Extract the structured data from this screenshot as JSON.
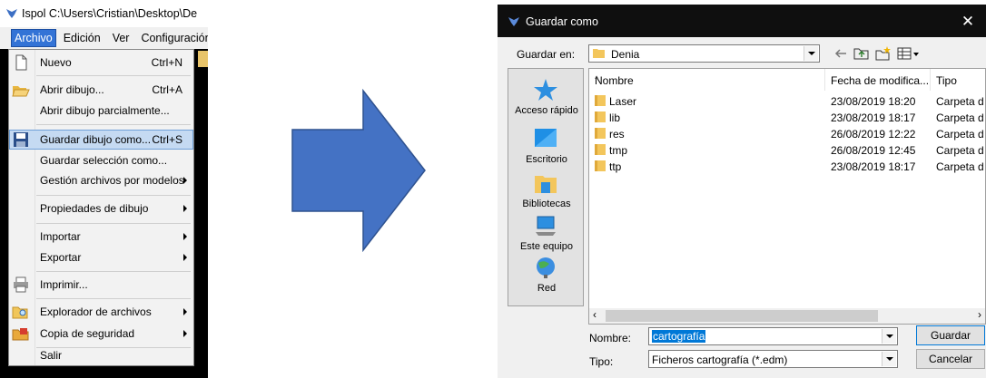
{
  "app": {
    "title": "Ispol  C:\\Users\\Cristian\\Desktop\\De",
    "menubar": [
      "Archivo",
      "Edición",
      "Ver",
      "Configuración"
    ]
  },
  "menu": {
    "items": [
      {
        "label": "Nuevo",
        "shortcut": "Ctrl+N",
        "icon": "new-document-icon"
      },
      {
        "label": "Abrir dibujo...",
        "shortcut": "Ctrl+A",
        "icon": "open-folder-icon"
      },
      {
        "label": "Abrir dibujo parcialmente...",
        "shortcut": ""
      },
      {
        "label": "Guardar dibujo como...",
        "shortcut": "Ctrl+S",
        "icon": "floppy-disk-icon"
      },
      {
        "label": "Guardar selección como...",
        "shortcut": ""
      },
      {
        "label": "Gestión archivos por modelos",
        "shortcut": "",
        "submenu": true
      },
      {
        "label": "Propiedades de dibujo",
        "shortcut": "",
        "submenu": true
      },
      {
        "label": "Importar",
        "shortcut": "",
        "submenu": true
      },
      {
        "label": "Exportar",
        "shortcut": "",
        "submenu": true
      },
      {
        "label": "Imprimir...",
        "shortcut": "",
        "icon": "printer-icon"
      },
      {
        "label": "Explorador de archivos",
        "shortcut": "",
        "submenu": true,
        "icon": "folder-search-icon"
      },
      {
        "label": "Copia de seguridad",
        "shortcut": "",
        "submenu": true,
        "icon": "backup-icon"
      },
      {
        "label": "Salir",
        "shortcut": ""
      }
    ]
  },
  "dialog": {
    "title": "Guardar como",
    "close_glyph": "✕",
    "lookin_label": "Guardar en:",
    "lookin_value": "Denia",
    "places": [
      "Acceso rápido",
      "Escritorio",
      "Bibliotecas",
      "Este equipo",
      "Red"
    ],
    "columns": [
      "Nombre",
      "Fecha de modifica...",
      "Tipo"
    ],
    "files": [
      {
        "name": "Laser",
        "date": "23/08/2019 18:20",
        "type": "Carpeta d"
      },
      {
        "name": "lib",
        "date": "23/08/2019 18:17",
        "type": "Carpeta d"
      },
      {
        "name": "res",
        "date": "26/08/2019 12:22",
        "type": "Carpeta d"
      },
      {
        "name": "tmp",
        "date": "26/08/2019 12:45",
        "type": "Carpeta d"
      },
      {
        "name": "ttp",
        "date": "23/08/2019 18:17",
        "type": "Carpeta d"
      }
    ],
    "filename_label": "Nombre:",
    "filename_value": "cartografía",
    "filetype_label": "Tipo:",
    "filetype_value": "Ficheros cartografía (*.edm)",
    "save_label": "Guardar",
    "cancel_label": "Cancelar"
  },
  "colors": {
    "arrow_fill": "#4472c4",
    "arrow_stroke": "#2f528f",
    "highlight": "#c5daf2",
    "selection": "#0078d7"
  }
}
